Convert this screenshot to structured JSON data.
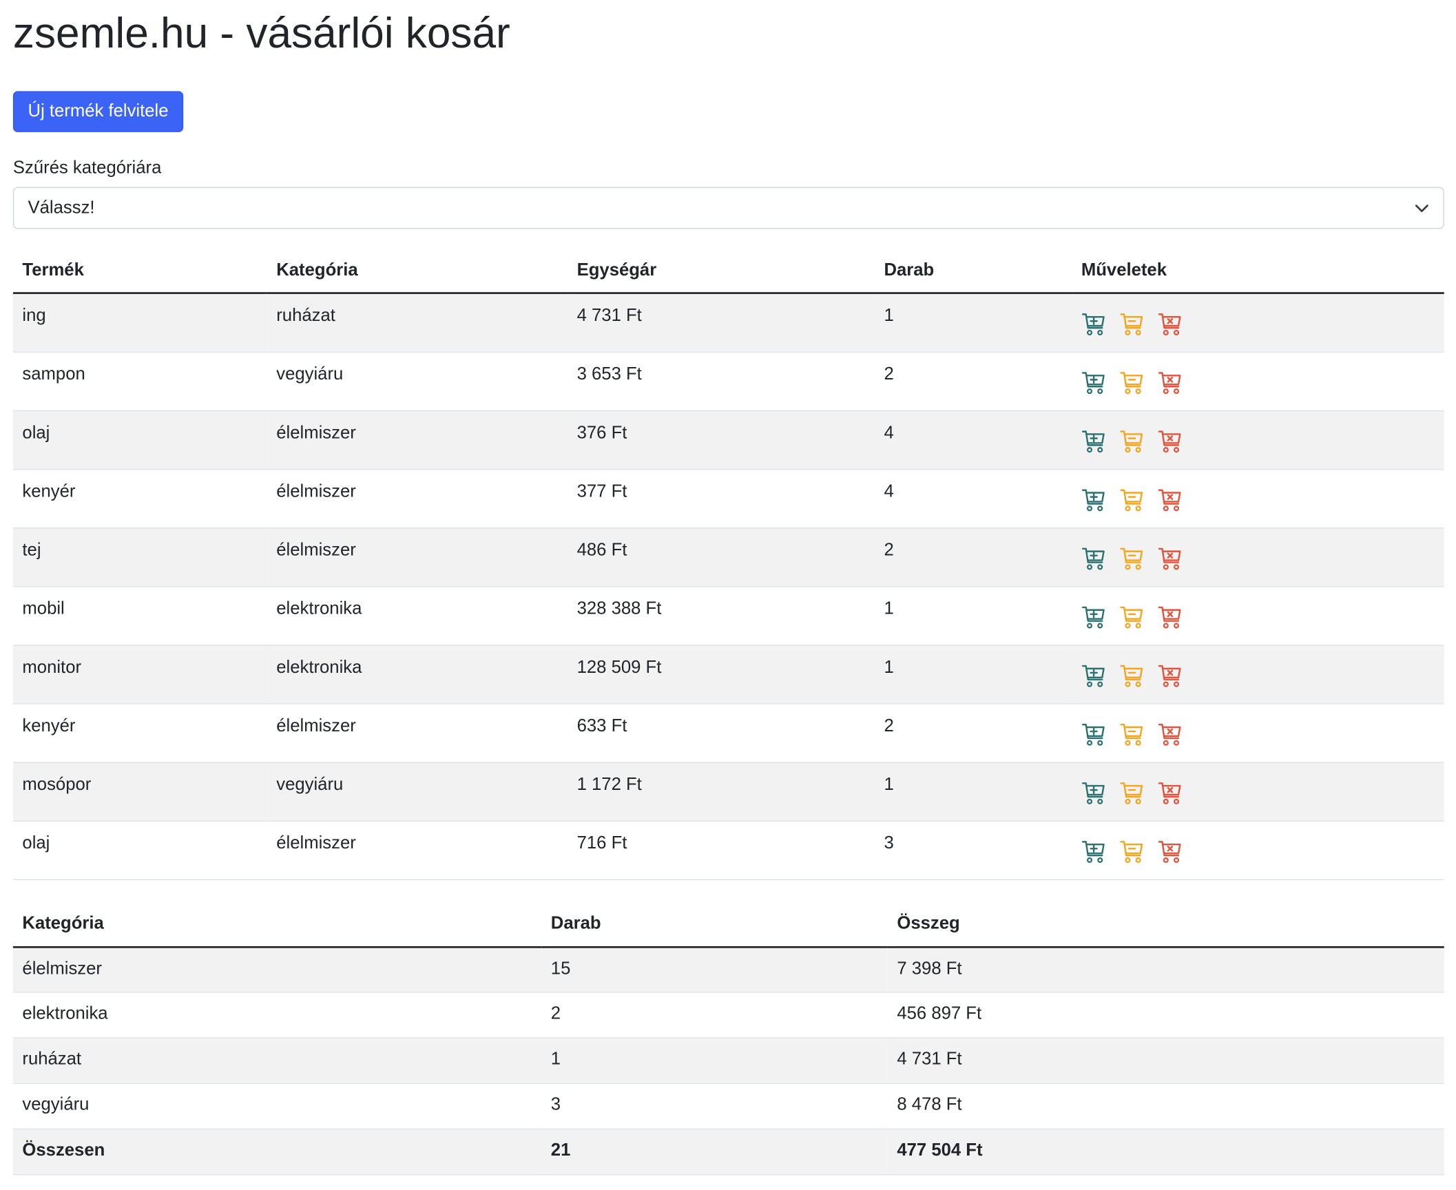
{
  "header": {
    "title": "zsemle.hu - vásárlói kosár"
  },
  "actions": {
    "new_product_label": "Új termék felvitele"
  },
  "filter": {
    "label": "Szűrés kategóriára",
    "selected": "Válassz!"
  },
  "products": {
    "columns": [
      "Termék",
      "Kategória",
      "Egységár",
      "Darab",
      "Műveletek"
    ],
    "rows": [
      {
        "name": "ing",
        "category": "ruházat",
        "price": "4 731 Ft",
        "qty": "1"
      },
      {
        "name": "sampon",
        "category": "vegyiáru",
        "price": "3 653 Ft",
        "qty": "2"
      },
      {
        "name": "olaj",
        "category": "élelmiszer",
        "price": "376 Ft",
        "qty": "4"
      },
      {
        "name": "kenyér",
        "category": "élelmiszer",
        "price": "377 Ft",
        "qty": "4"
      },
      {
        "name": "tej",
        "category": "élelmiszer",
        "price": "486 Ft",
        "qty": "2"
      },
      {
        "name": "mobil",
        "category": "elektronika",
        "price": "328 388 Ft",
        "qty": "1"
      },
      {
        "name": "monitor",
        "category": "elektronika",
        "price": "128 509 Ft",
        "qty": "1"
      },
      {
        "name": "kenyér",
        "category": "élelmiszer",
        "price": "633 Ft",
        "qty": "2"
      },
      {
        "name": "mosópor",
        "category": "vegyiáru",
        "price": "1 172 Ft",
        "qty": "1"
      },
      {
        "name": "olaj",
        "category": "élelmiszer",
        "price": "716 Ft",
        "qty": "3"
      }
    ],
    "icons": [
      "cart-plus-icon",
      "cart-dash-icon",
      "cart-x-icon"
    ]
  },
  "summary": {
    "columns": [
      "Kategória",
      "Darab",
      "Összeg"
    ],
    "rows": [
      {
        "category": "élelmiszer",
        "qty": "15",
        "sum": "7 398 Ft"
      },
      {
        "category": "elektronika",
        "qty": "2",
        "sum": "456 897 Ft"
      },
      {
        "category": "ruházat",
        "qty": "1",
        "sum": "4 731 Ft"
      },
      {
        "category": "vegyiáru",
        "qty": "3",
        "sum": "8 478 Ft"
      }
    ],
    "total": {
      "label": "Összesen",
      "qty": "21",
      "sum": "477 504 Ft"
    }
  },
  "colors": {
    "primary": "#3b63f6",
    "cart_plus": "#2a7170",
    "cart_dash": "#f4a51c",
    "cart_x": "#e4523b"
  }
}
